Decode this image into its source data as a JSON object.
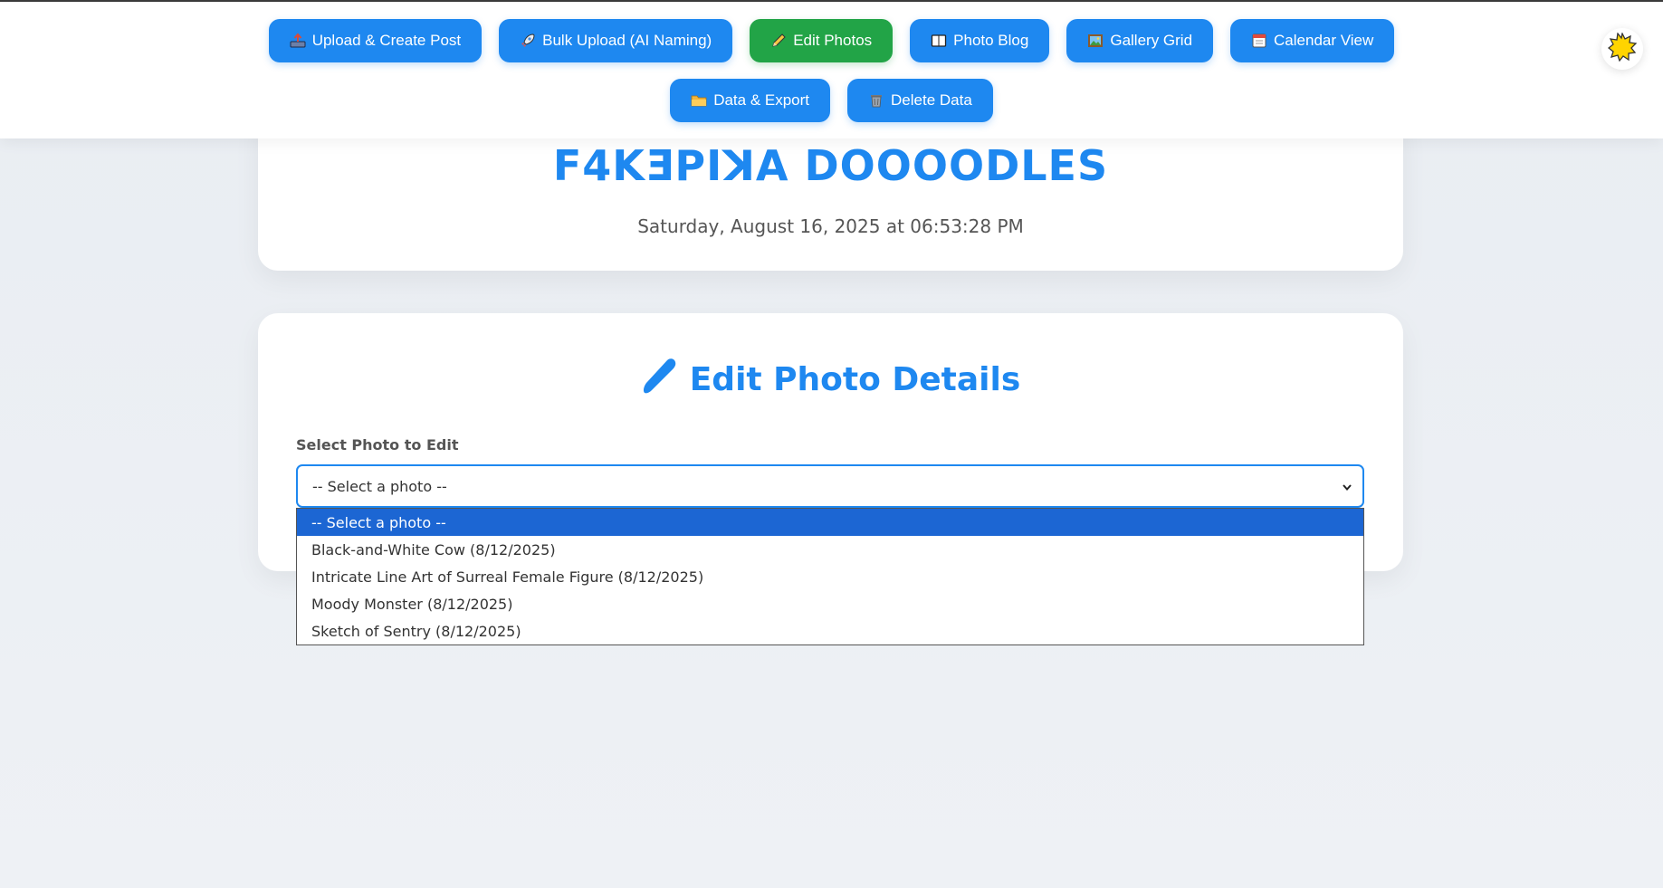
{
  "nav": {
    "row1": [
      {
        "icon": "inbox-tray-icon",
        "label": "Upload & Create Post"
      },
      {
        "icon": "rocket-icon",
        "label": "Bulk Upload (AI Naming)"
      },
      {
        "icon": "pencil-icon",
        "label": "Edit Photos",
        "active": true
      },
      {
        "icon": "book-icon",
        "label": "Photo Blog"
      },
      {
        "icon": "picture-icon",
        "label": "Gallery Grid"
      },
      {
        "icon": "calendar-icon",
        "label": "Calendar View"
      }
    ],
    "row2": [
      {
        "icon": "folder-icon",
        "label": "Data & Export"
      },
      {
        "icon": "trash-icon",
        "label": "Delete Data"
      }
    ],
    "theme_toggle_icon": "sun-icon"
  },
  "header": {
    "site_title": "F4KƎPIꓘA DOOOODLES",
    "datetime": "Saturday, August 16, 2025 at 06:53:28 PM"
  },
  "edit_section": {
    "title": "Edit Photo Details",
    "title_icon": "pencil-icon",
    "select_label": "Select Photo to Edit",
    "select_value": "-- Select a photo --",
    "options": [
      "-- Select a photo --",
      "Black-and-White Cow (8/12/2025)",
      "Intricate Line Art of Surreal Female Figure (8/12/2025)",
      "Moody Monster (8/12/2025)",
      "Sketch of Sentry (8/12/2025)"
    ],
    "selected_index": 0
  },
  "colors": {
    "accent": "#1e88f0",
    "active": "#22a447",
    "option_highlight": "#1c66d3"
  }
}
